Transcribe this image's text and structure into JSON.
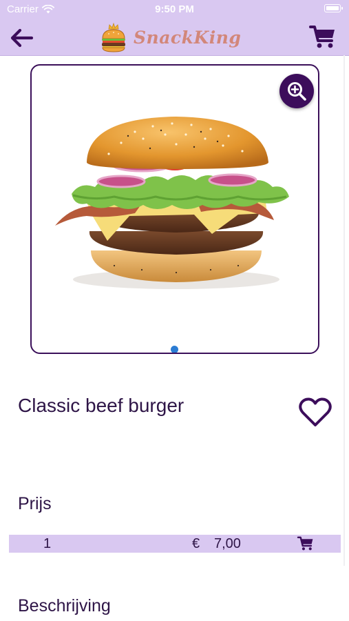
{
  "status_bar": {
    "carrier": "Carrier",
    "time": "9:50 PM"
  },
  "nav": {
    "brand_name": "SnackKing",
    "back_icon": "arrow-left-icon",
    "cart_icon": "shopping-cart-icon",
    "color": "#3c0d5b"
  },
  "gallery": {
    "image": "classic-beef-burger-photo",
    "zoom_icon": "zoom-in-icon",
    "page_count": 1,
    "active_page": 1
  },
  "product": {
    "title": "Classic beef burger",
    "favorite_icon": "heart-outline-icon"
  },
  "price": {
    "section_label": "Prijs",
    "quantity": "1",
    "currency": "€",
    "amount": "7,00",
    "add_icon": "shopping-cart-icon"
  },
  "description": {
    "section_label": "Beschrijving"
  },
  "colors": {
    "header_bg": "#d9c8f1",
    "accent": "#3c0d5b",
    "brand_text": "#d2877a",
    "page_dot": "#2b7cd3"
  }
}
